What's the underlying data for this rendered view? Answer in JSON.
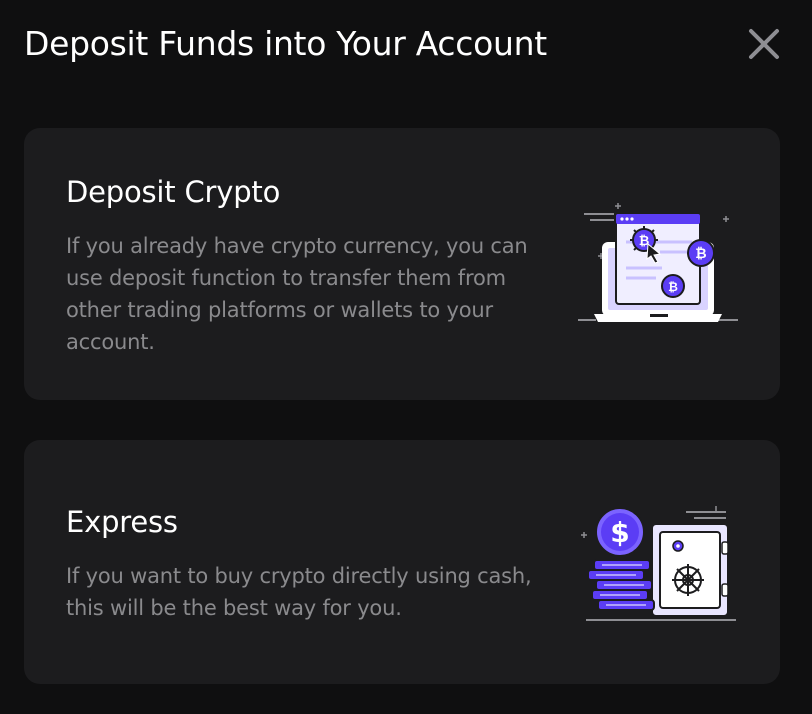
{
  "modal": {
    "title": "Deposit Funds into Your Account"
  },
  "options": [
    {
      "title": "Deposit Crypto",
      "description": "If you already have crypto currency, you can use deposit function to transfer them from other trading platforms or wallets to your account.",
      "illustration": "laptop-bitcoin-illustration"
    },
    {
      "title": "Express",
      "description": "If you want to buy crypto directly using cash, this will be the best way for you.",
      "illustration": "coins-safe-illustration"
    }
  ],
  "colors": {
    "background": "#0f0f10",
    "card": "#1c1c1e",
    "title_text": "#ffffff",
    "description_text": "#8a8a8d",
    "accent_purple": "#5b3df5",
    "accent_light_purple": "#e9e6ff"
  }
}
